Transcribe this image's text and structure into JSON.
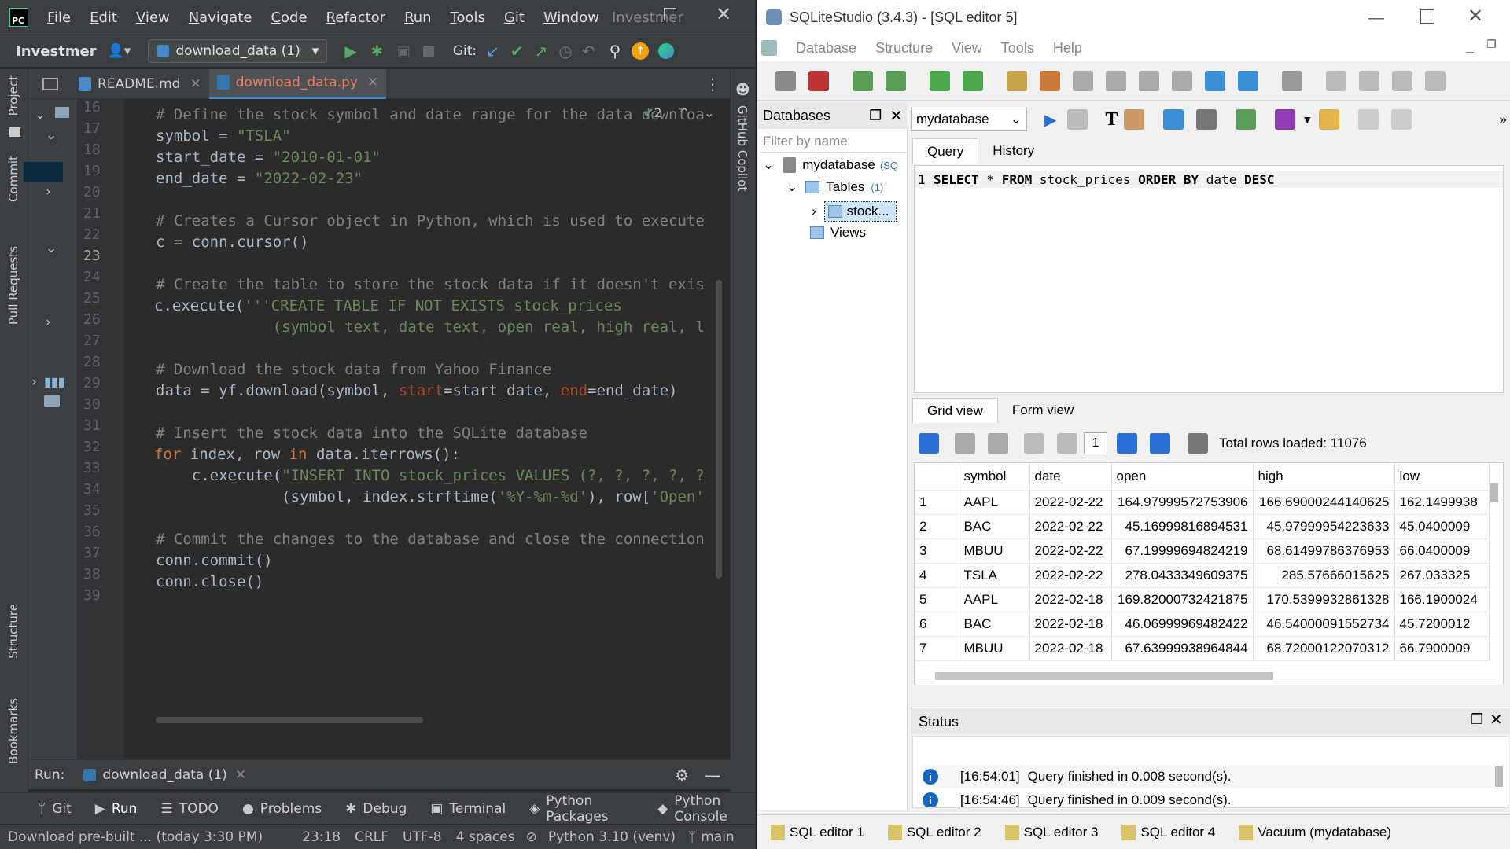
{
  "ide": {
    "menu": [
      "File",
      "Edit",
      "View",
      "Navigate",
      "Code",
      "Refactor",
      "Run",
      "Tools",
      "Git",
      "Window"
    ],
    "window_title": "Investmer",
    "project": "Investmer",
    "run_config": "download_data (1)",
    "git_label": "Git:",
    "tabs": [
      {
        "label": "README.md"
      },
      {
        "label": "download_data.py"
      }
    ],
    "inspections": "2",
    "left_labels": [
      "Project",
      "Commit",
      "Pull Requests",
      "Structure",
      "Bookmarks"
    ],
    "right_label": "GitHub Copilot",
    "line_numbers": [
      "16",
      "17",
      "18",
      "19",
      "20",
      "21",
      "22",
      "23",
      "24",
      "25",
      "26",
      "27",
      "28",
      "29",
      "30",
      "31",
      "32",
      "33",
      "34",
      "35",
      "36",
      "37",
      "38",
      "39"
    ],
    "code": {
      "l17": "# Define the stock symbol and date range for the data downloa",
      "l18_a": "symbol = ",
      "l18_b": "\"TSLA\"",
      "l19_a": "start_date = ",
      "l19_b": "\"2010-01-01\"",
      "l20_a": "end_date = ",
      "l20_b": "\"2022-02-23\"",
      "l22": "# Creates a Cursor object in Python, which is used to execute",
      "l23": "c = conn.cursor()",
      "l25": "# Create the table to store the stock data if it doesn't exis",
      "l26_a": "c.execute(",
      "l26_b": "'''CREATE TABLE IF NOT EXISTS stock_prices",
      "l27": "             (symbol text, date text, open real, high real, l",
      "l29": "# Download the stock data from Yahoo Finance",
      "l30_a": "data = yf.download(symbol, ",
      "l30_b": "start",
      "l30_c": "=start_date, ",
      "l30_d": "end",
      "l30_e": "=end_date)",
      "l32": "# Insert the stock data into the SQLite database",
      "l33_a": "for",
      "l33_b": " index, row ",
      "l33_c": "in",
      "l33_d": " data.iterrows():",
      "l34_a": "    c.execute(",
      "l34_b": "\"INSERT INTO stock_prices VALUES (?, ?, ?, ?, ?",
      "l35_a": "              (symbol, index.strftime(",
      "l35_b": "'%Y-%m-%d'",
      "l35_c": "), row[",
      "l35_d": "'Open'",
      "l37": "# Commit the changes to the database and close the connection",
      "l38": "conn.commit()",
      "l39": "conn.close()"
    },
    "run": {
      "label": "Run:",
      "config": "download_data (1)"
    },
    "toolwindows": [
      "Git",
      "Run",
      "TODO",
      "Problems",
      "Debug",
      "Terminal",
      "Python Packages",
      "Python Console"
    ],
    "status": {
      "message": "Download pre-built ... (today 3:30 PM)",
      "pos": "23:18",
      "eol": "CRLF",
      "enc": "UTF-8",
      "indent": "4 spaces",
      "interp": "Python 3.10 (venv)",
      "branch": "main"
    }
  },
  "sqs": {
    "title": "SQLiteStudio (3.4.3) - [SQL editor 5]",
    "menu": [
      "Database",
      "Structure",
      "View",
      "Tools",
      "Help"
    ],
    "db_panel_title": "Databases",
    "filter_placeholder": "Filter by name",
    "tree": {
      "db": "mydatabase",
      "db_tag": "(SQ",
      "tables": "Tables",
      "tables_count": "(1)",
      "table": "stock...",
      "views": "Views"
    },
    "db_combo": "mydatabase",
    "query_tabs": [
      "Query",
      "History"
    ],
    "sql": {
      "line": "1",
      "kw1": "SELECT",
      "t1": " * ",
      "kw2": "FROM",
      "t2": " stock_prices ",
      "kw3": "ORDER BY",
      "t3": " date ",
      "kw4": "DESC"
    },
    "grid_tabs": [
      "Grid view",
      "Form view"
    ],
    "page": "1",
    "total_rows": "Total rows loaded: 11076",
    "columns": [
      "symbol",
      "date",
      "open",
      "high",
      "low"
    ],
    "rows": [
      [
        "1",
        "AAPL",
        "2022-02-22",
        "164.97999572753906",
        "166.69000244140625",
        "162.1499938"
      ],
      [
        "2",
        "BAC",
        "2022-02-22",
        "45.16999816894531",
        "45.97999954223633",
        "45.0400009"
      ],
      [
        "3",
        "MBUU",
        "2022-02-22",
        "67.19999694824219",
        "68.61499786376953",
        "66.0400009"
      ],
      [
        "4",
        "TSLA",
        "2022-02-22",
        "278.0433349609375",
        "285.57666015625",
        "267.033325"
      ],
      [
        "5",
        "AAPL",
        "2022-02-18",
        "169.82000732421875",
        "170.5399932861328",
        "166.1900024"
      ],
      [
        "6",
        "BAC",
        "2022-02-18",
        "46.06999969482422",
        "46.54000091552734",
        "45.7200012"
      ],
      [
        "7",
        "MBUU",
        "2022-02-18",
        "67.63999938964844",
        "68.72000122070312",
        "66.7900009"
      ]
    ],
    "status_title": "Status",
    "messages": [
      {
        "time": "[16:54:01]",
        "text": "Query finished in 0.008 second(s)."
      },
      {
        "time": "[16:54:46]",
        "text": "Query finished in 0.009 second(s)."
      }
    ],
    "bottom_tabs": [
      "SQL editor 1",
      "SQL editor 2",
      "SQL editor 3",
      "SQL editor 4",
      "Vacuum (mydatabase)"
    ]
  }
}
